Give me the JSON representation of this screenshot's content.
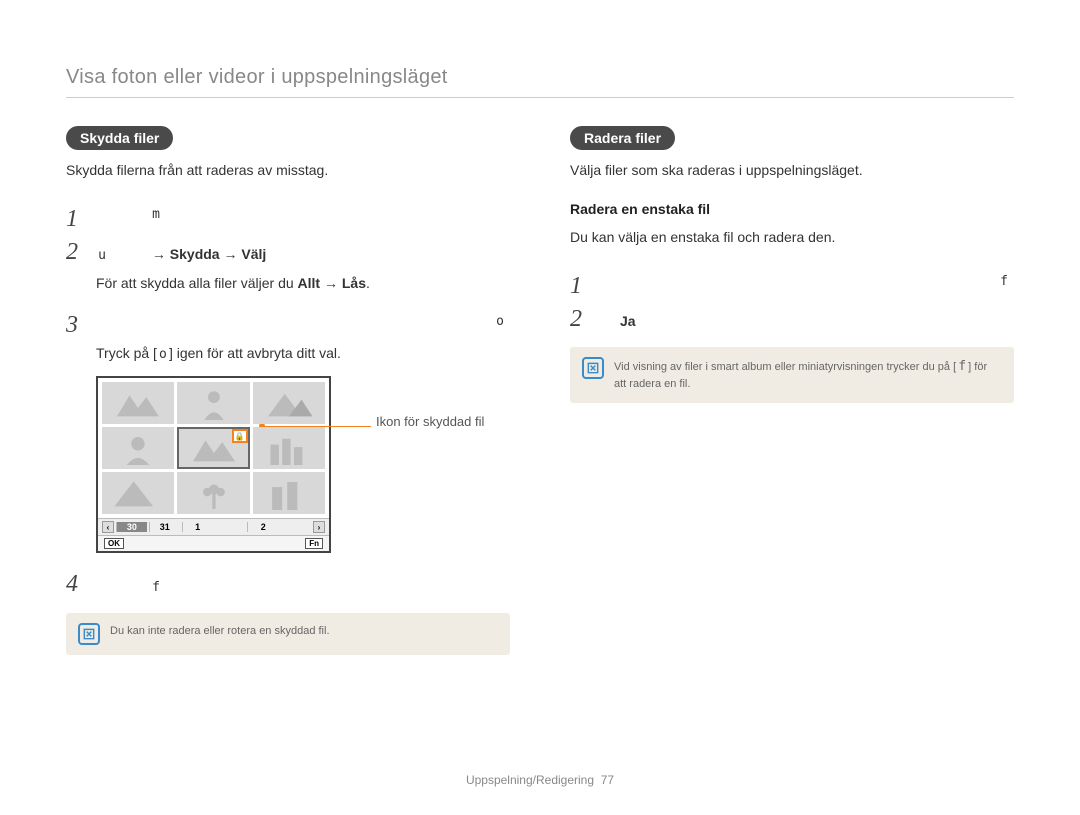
{
  "header": {
    "title": "Visa foton eller videor i uppspelningsläget"
  },
  "left": {
    "pill": "Skydda filer",
    "desc": "Skydda filerna från att raderas av misstag.",
    "step1_sym": "m",
    "step2_prefix": "u",
    "step2_bold1": "Skydda",
    "step2_bold2": "Välj",
    "step2_note_prefix": "För att skydda alla filer väljer du ",
    "step2_note_bold1": "Allt",
    "step2_note_bold2": "Lås",
    "step3_sym": "o",
    "step3_abort": "Tryck på [",
    "step3_abort_sym": "o",
    "step3_abort_tail": "] igen för att avbryta ditt val.",
    "figure": {
      "callout": "Ikon för skyddad fil",
      "timeline_cells": [
        "30",
        "31",
        "1",
        "",
        "2",
        ""
      ],
      "bottombar_left": "OK",
      "bottombar_right": "Fn"
    },
    "step4_sym": "f",
    "note": "Du kan inte radera eller rotera en skyddad fil."
  },
  "right": {
    "pill": "Radera filer",
    "desc": "Välja filer som ska raderas i uppspelningsläget.",
    "subheading": "Radera en enstaka fil",
    "subdesc": "Du kan välja en enstaka fil och radera den.",
    "step1_sym": "f",
    "step2_text": "Ja",
    "note_prefix": "Vid visning av filer i smart album eller miniatyrvisningen trycker du på [",
    "note_sym": "f",
    "note_tail": "] för att radera en fil."
  },
  "footer": {
    "section": "Uppspelning/Redigering",
    "page": "77"
  }
}
